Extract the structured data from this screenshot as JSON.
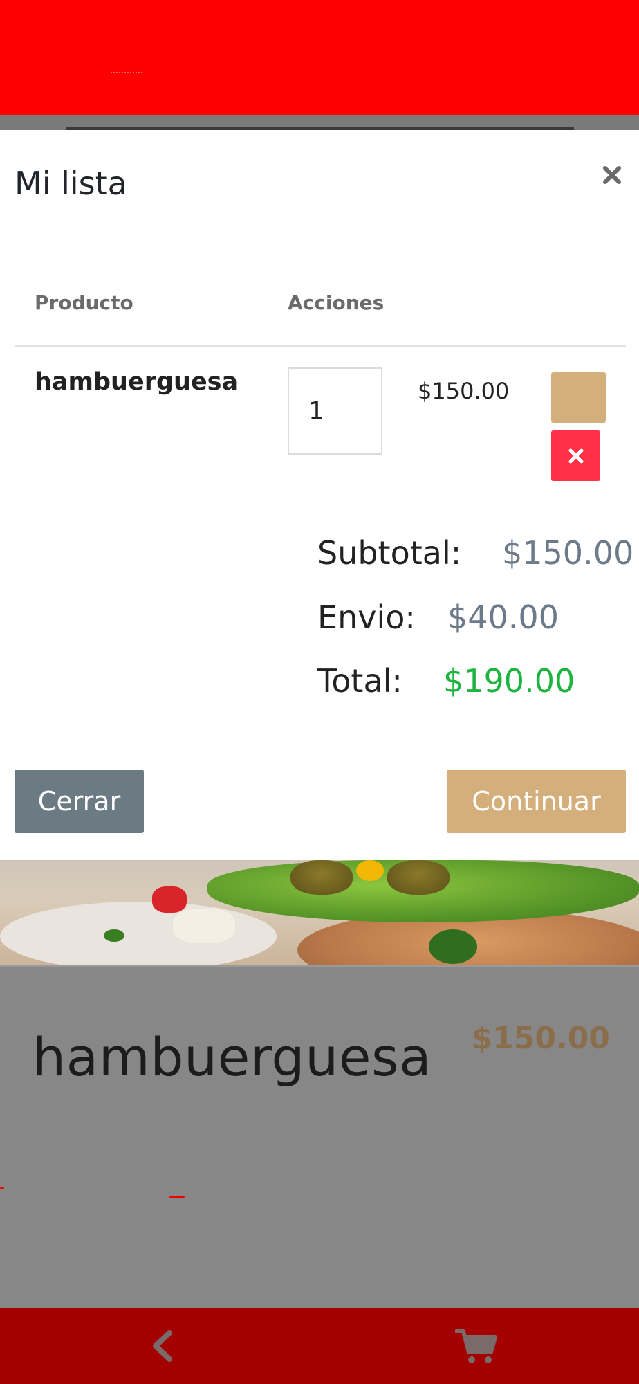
{
  "modal": {
    "title": "Mi lista",
    "close_icon": "close-icon",
    "table": {
      "headers": [
        "Producto",
        "Acciones"
      ],
      "rows": [
        {
          "product": "hambuerguesa",
          "quantity": "1",
          "price": "$150.00",
          "edit_icon": "edit-button-blank",
          "delete_icon": "close-icon"
        }
      ]
    },
    "summary": {
      "subtotal_label": "Subtotal:",
      "subtotal_value": "$150.00",
      "envio_label": "Envio:",
      "envio_value": "$40.00",
      "total_label": "Total:",
      "total_value": "$190.00"
    },
    "buttons": {
      "close_label": "Cerrar",
      "continue_label": "Continuar"
    }
  },
  "background_page": {
    "product_name": "hambuerguesa",
    "product_price": "$150.00"
  },
  "bottom_nav": {
    "back_icon": "chevron-left-icon",
    "cart_icon": "cart-icon"
  },
  "colors": {
    "top_bar": "#ff0000",
    "bottom_bar": "#a50000",
    "accent_tan": "#d4ae7b",
    "danger": "#ff3047",
    "total_green": "#1db43f",
    "muted_value": "#6c7a89",
    "secondary_button": "#6c7a84"
  }
}
